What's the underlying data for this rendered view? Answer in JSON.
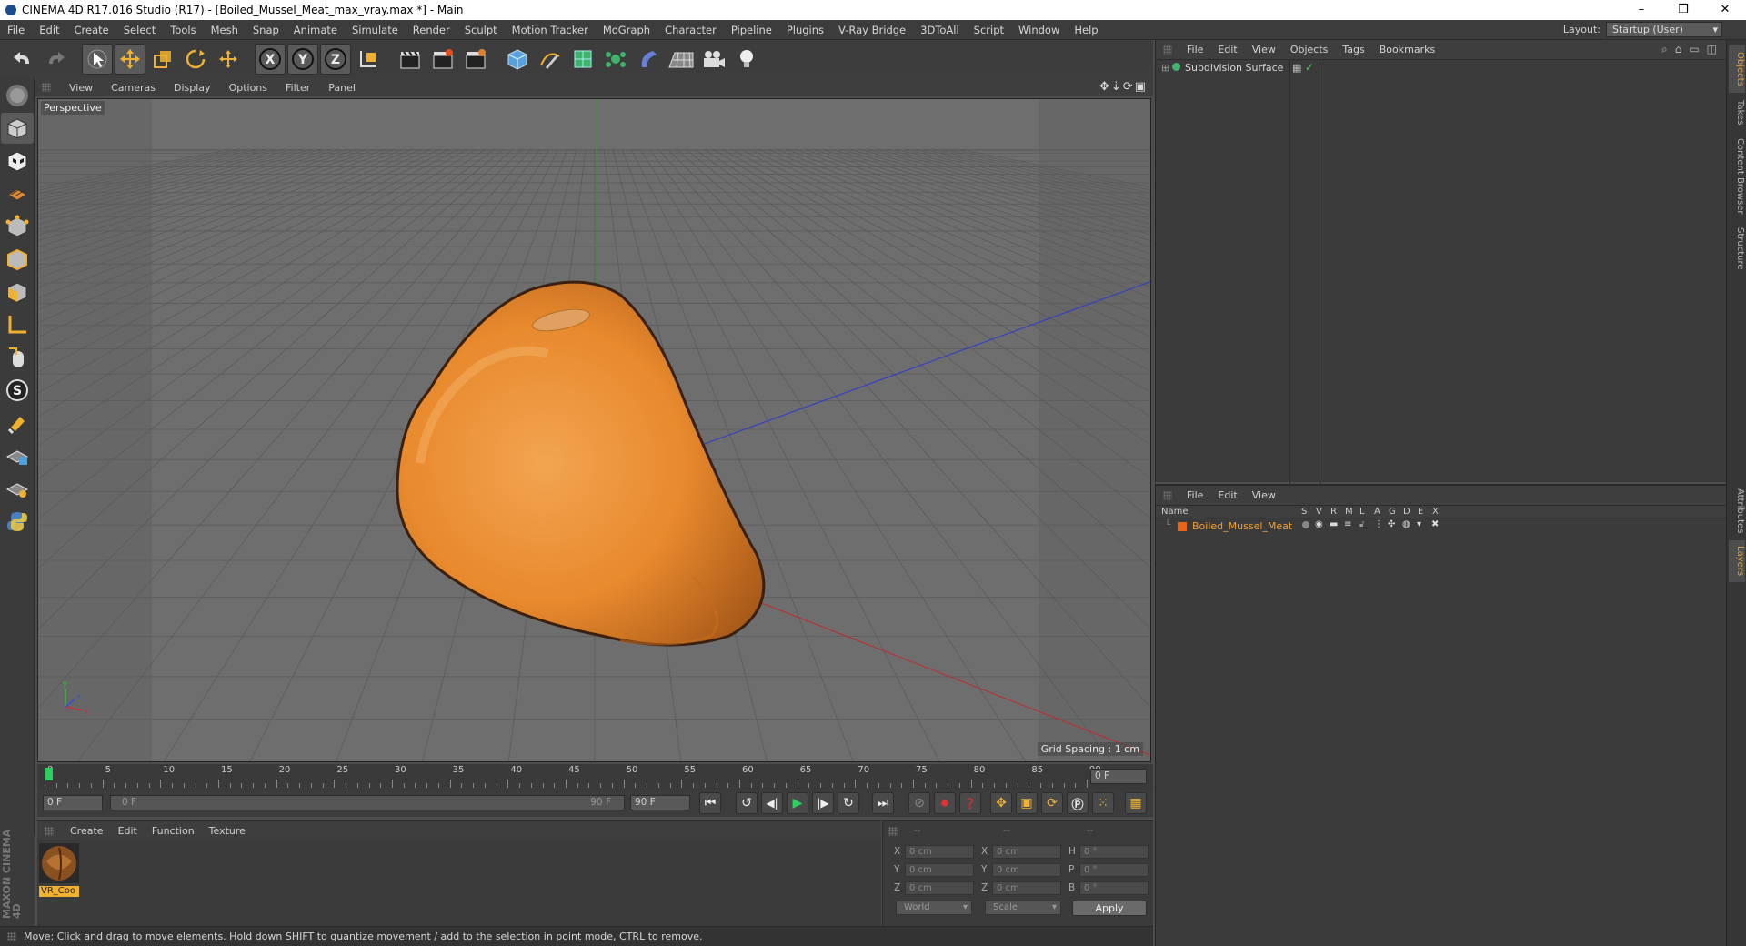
{
  "window": {
    "title": "CINEMA 4D R17.016 Studio (R17) - [Boiled_Mussel_Meat_max_vray.max *] - Main",
    "controls": [
      "–",
      "❒",
      "✕"
    ]
  },
  "menubar": {
    "items": [
      "File",
      "Edit",
      "Create",
      "Select",
      "Tools",
      "Mesh",
      "Snap",
      "Animate",
      "Simulate",
      "Render",
      "Sculpt",
      "Motion Tracker",
      "MoGraph",
      "Character",
      "Pipeline",
      "Plugins",
      "V-Ray Bridge",
      "3DToAll",
      "Script",
      "Window",
      "Help"
    ],
    "layout_label": "Layout:",
    "layout_value": "Startup (User)"
  },
  "viewport": {
    "menu": [
      "View",
      "Cameras",
      "Display",
      "Options",
      "Filter",
      "Panel"
    ],
    "label": "Perspective",
    "grid_spacing": "Grid Spacing : 1 cm",
    "object_color": "#e8892d"
  },
  "timeline": {
    "ticks": [
      "0",
      "5",
      "10",
      "15",
      "20",
      "25",
      "30",
      "35",
      "40",
      "45",
      "50",
      "55",
      "60",
      "65",
      "70",
      "75",
      "80",
      "85",
      "90"
    ],
    "current_frame": "0 F",
    "start_field": "0 F",
    "range_start": "0 F",
    "range_end": "90 F",
    "end_field": "90 F"
  },
  "material_panel": {
    "menu": [
      "Create",
      "Edit",
      "Function",
      "Texture"
    ],
    "material_name": "VR_Coo"
  },
  "coordinates": {
    "headers": [
      "--",
      "--",
      "--"
    ],
    "rows": [
      {
        "a": "X",
        "av": "0 cm",
        "b": "X",
        "bv": "0 cm",
        "c": "H",
        "cv": "0 °"
      },
      {
        "a": "Y",
        "av": "0 cm",
        "b": "Y",
        "bv": "0 cm",
        "c": "P",
        "cv": "0 °"
      },
      {
        "a": "Z",
        "av": "0 cm",
        "b": "Z",
        "bv": "0 cm",
        "c": "B",
        "cv": "0 °"
      }
    ],
    "world": "World",
    "scale": "Scale",
    "apply": "Apply"
  },
  "status": "Move: Click and drag to move elements. Hold down SHIFT to quantize movement / add to the selection in point mode, CTRL to remove.",
  "object_manager": {
    "menu": [
      "File",
      "Edit",
      "View",
      "Objects",
      "Tags",
      "Bookmarks"
    ],
    "object": "Subdivision Surface"
  },
  "layer_manager": {
    "menu": [
      "File",
      "Edit",
      "View"
    ],
    "columns": [
      "Name",
      "S",
      "V",
      "R",
      "M",
      "L",
      "A",
      "G",
      "D",
      "E",
      "X"
    ],
    "layer_name": "Boiled_Mussel_Meat",
    "layer_color": "#e8661a"
  },
  "side_tabs": [
    "Objects",
    "Takes",
    "Content Browser",
    "Structure",
    "Attributes",
    "Layers"
  ],
  "logo": "MAXON CINEMA 4D"
}
